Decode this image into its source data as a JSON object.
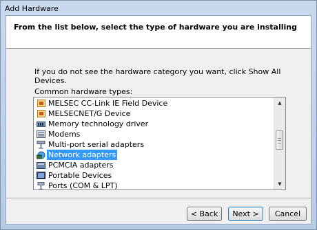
{
  "window": {
    "title": "Add Hardware"
  },
  "header": {
    "title": "From the list below, select the type of hardware you are installing"
  },
  "body": {
    "instruction": "If you do not see the hardware category you want, click Show All Devices.",
    "list_label": "Common hardware types:"
  },
  "list": {
    "items": [
      {
        "label": "MELSEC CC-Link IE Field Device",
        "icon": "melsec-icon",
        "selected": false
      },
      {
        "label": "MELSECNET/G Device",
        "icon": "melsec-icon",
        "selected": false
      },
      {
        "label": "Memory technology driver",
        "icon": "memory-icon",
        "selected": false
      },
      {
        "label": "Modems",
        "icon": "modem-icon",
        "selected": false
      },
      {
        "label": "Multi-port serial adapters",
        "icon": "serial-adapter-icon",
        "selected": false
      },
      {
        "label": "Network adapters",
        "icon": "network-adapter-icon",
        "selected": true
      },
      {
        "label": "PCMCIA adapters",
        "icon": "pcmcia-icon",
        "selected": false
      },
      {
        "label": "Portable Devices",
        "icon": "portable-device-icon",
        "selected": false
      },
      {
        "label": "Ports (COM & LPT)",
        "icon": "ports-icon",
        "selected": false
      }
    ]
  },
  "buttons": {
    "back": "< Back",
    "next": "Next >",
    "cancel": "Cancel"
  },
  "colors": {
    "selection": "#3399ff",
    "frame": "#c6d6ea"
  }
}
